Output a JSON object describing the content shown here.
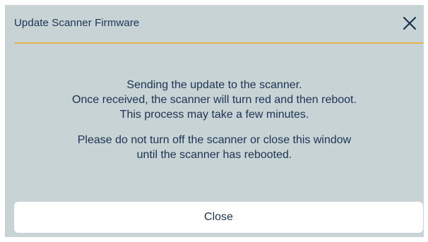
{
  "dialog": {
    "title": "Update Scanner Firmware",
    "close_icon": "close-icon",
    "accent_color": "#e6b44a",
    "text_color": "#1d3353",
    "background_color": "#c7d3d4"
  },
  "message": {
    "paragraph1": [
      "Sending the update to the scanner.",
      "Once received, the scanner will turn red and then reboot.",
      "This process may take a few minutes."
    ],
    "paragraph2": [
      "Please do not turn off the scanner or close this window",
      "until the scanner has rebooted."
    ]
  },
  "footer": {
    "close_label": "Close"
  }
}
